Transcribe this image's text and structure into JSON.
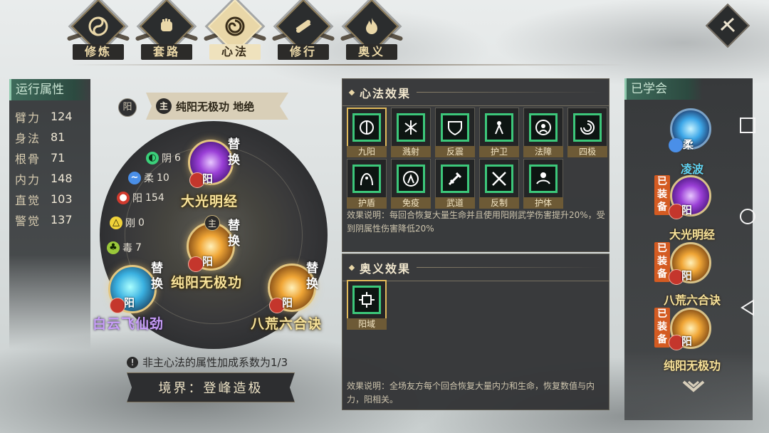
{
  "tabs": [
    {
      "label": "修炼",
      "icon": "yinyang-icon",
      "active": false
    },
    {
      "label": "套路",
      "icon": "fist-icon",
      "active": false
    },
    {
      "label": "心法",
      "icon": "swirl-icon",
      "active": true
    },
    {
      "label": "修行",
      "icon": "scroll-icon",
      "active": false
    },
    {
      "label": "奥义",
      "icon": "flame-icon",
      "active": false
    }
  ],
  "stats": {
    "title": "运行属性",
    "rows": [
      {
        "k": "臂力",
        "v": "124"
      },
      {
        "k": "身法",
        "v": "81"
      },
      {
        "k": "根骨",
        "v": "71"
      },
      {
        "k": "内力",
        "v": "148"
      },
      {
        "k": "直觉",
        "v": "103"
      },
      {
        "k": "警觉",
        "v": "137"
      }
    ]
  },
  "center": {
    "yang_label": "阳",
    "zhu_label": "主",
    "main_title": "纯阳无极功 地绝",
    "swap_label": "替换",
    "yang_badge": "阳",
    "yin_badge": "阴",
    "rou_badge": "柔",
    "gang_badge": "刚",
    "du_badge": "毒",
    "attrs": {
      "yin": "6",
      "rou": "10",
      "yang": "154",
      "gang": "0",
      "du": "7"
    },
    "skills": {
      "top": "大光明经",
      "center": "纯阳无极功",
      "left": "白云飞仙劲",
      "right": "八荒六合诀"
    },
    "note": "非主心法的属性加成系数为1/3",
    "realm": "境界：登峰造极"
  },
  "xinfa": {
    "title": "心法效果",
    "effects": [
      "九阳",
      "溅射",
      "反震",
      "护卫",
      "法障",
      "四极",
      "护盾",
      "免疫",
      "武道",
      "反制",
      "护体"
    ],
    "desc": "效果说明：每回合恢复大量生命并且使用阳刚武学伤害提升20%，受到阴属性伤害降低20%"
  },
  "aoyi": {
    "title": "奥义效果",
    "effects": [
      "阳域"
    ],
    "desc": "效果说明：全场友方每个回合恢复大量内力和生命，恢复数值与内力，阳相关。"
  },
  "learned": {
    "title": "已学会",
    "equipped_label": "已装备",
    "items": [
      {
        "name": "凌波",
        "badge": "柔",
        "equipped": false
      },
      {
        "name": "大光明经",
        "badge": "阳",
        "equipped": true
      },
      {
        "name": "八荒六合诀",
        "badge": "阳",
        "equipped": true
      },
      {
        "name": "纯阳无极功",
        "badge": "阳",
        "equipped": true
      }
    ]
  },
  "colors": {
    "accent_gold": "#f7e29a",
    "equip_orange": "#d45b22",
    "effect_green": "#3cc77a",
    "header_green": "#3e6b5b"
  }
}
